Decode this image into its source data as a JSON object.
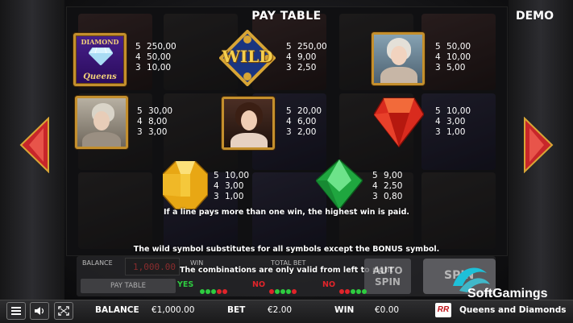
{
  "header": {
    "title": "PAY TABLE",
    "mode_badge": "DEMO"
  },
  "paytable": {
    "logo_symbol": {
      "line1": "DIAMOND",
      "line2": "Queens",
      "pays": [
        [
          "5",
          "250,00"
        ],
        [
          "4",
          "50,00"
        ],
        [
          "3",
          "10,00"
        ]
      ]
    },
    "wild_symbol": {
      "label": "WILD",
      "pays": [
        [
          "5",
          "250,00"
        ],
        [
          "4",
          "9,00"
        ],
        [
          "3",
          "2,50"
        ]
      ]
    },
    "marie_symbol": {
      "pays": [
        [
          "5",
          "50,00"
        ],
        [
          "4",
          "10,00"
        ],
        [
          "3",
          "5,00"
        ]
      ]
    },
    "catherine_symbol": {
      "pays": [
        [
          "5",
          "30,00"
        ],
        [
          "4",
          "8,00"
        ],
        [
          "3",
          "3,00"
        ]
      ]
    },
    "sisi_symbol": {
      "pays": [
        [
          "5",
          "20,00"
        ],
        [
          "4",
          "6,00"
        ],
        [
          "3",
          "2,00"
        ]
      ]
    },
    "ruby_symbol": {
      "pays": [
        [
          "5",
          "10,00"
        ],
        [
          "4",
          "3,00"
        ],
        [
          "3",
          "1,00"
        ]
      ]
    },
    "topaz_symbol": {
      "pays": [
        [
          "5",
          "10,00"
        ],
        [
          "4",
          "3,00"
        ],
        [
          "3",
          "1,00"
        ]
      ]
    },
    "emerald_symbol": {
      "pays": [
        [
          "5",
          "9,00"
        ],
        [
          "4",
          "2,50"
        ],
        [
          "3",
          "0,80"
        ]
      ]
    }
  },
  "rules": {
    "line1": "If a line pays more than one win, the highest win is paid.",
    "line2": "The wild symbol substitutes for all symbols except the BONUS symbol.",
    "line3": "The combinations are only valid from left to right"
  },
  "combos": {
    "yes": "YES",
    "no1": "NO",
    "no2": "NO"
  },
  "panel": {
    "balance_label": "BALANCE",
    "balance_digits": "1,000.00",
    "win_label": "WIN",
    "total_bet_label": "TOTAL BET",
    "paytable_button": "PAY TABLE",
    "autospin_line1": "AUTO",
    "autospin_line2": "SPIN",
    "spin_label": "SPIN"
  },
  "brand": {
    "provider": "SoftGamings"
  },
  "bottom_bar": {
    "balance_label": "BALANCE",
    "balance_value": "€1,000.00",
    "bet_label": "BET",
    "bet_value": "€2.00",
    "win_label": "WIN",
    "win_value": "€0.00",
    "studio_logo": "RR",
    "game_name": "Queens and Diamonds"
  },
  "icons": [
    "menu-icon",
    "sound-icon",
    "fullscreen-icon",
    "arrow-left-icon",
    "arrow-right-icon"
  ],
  "colors": {
    "gold": "#c48f2d",
    "arrow_red": "#c8262a",
    "combo_green": "#2ecc40",
    "combo_red": "#e0242a"
  }
}
